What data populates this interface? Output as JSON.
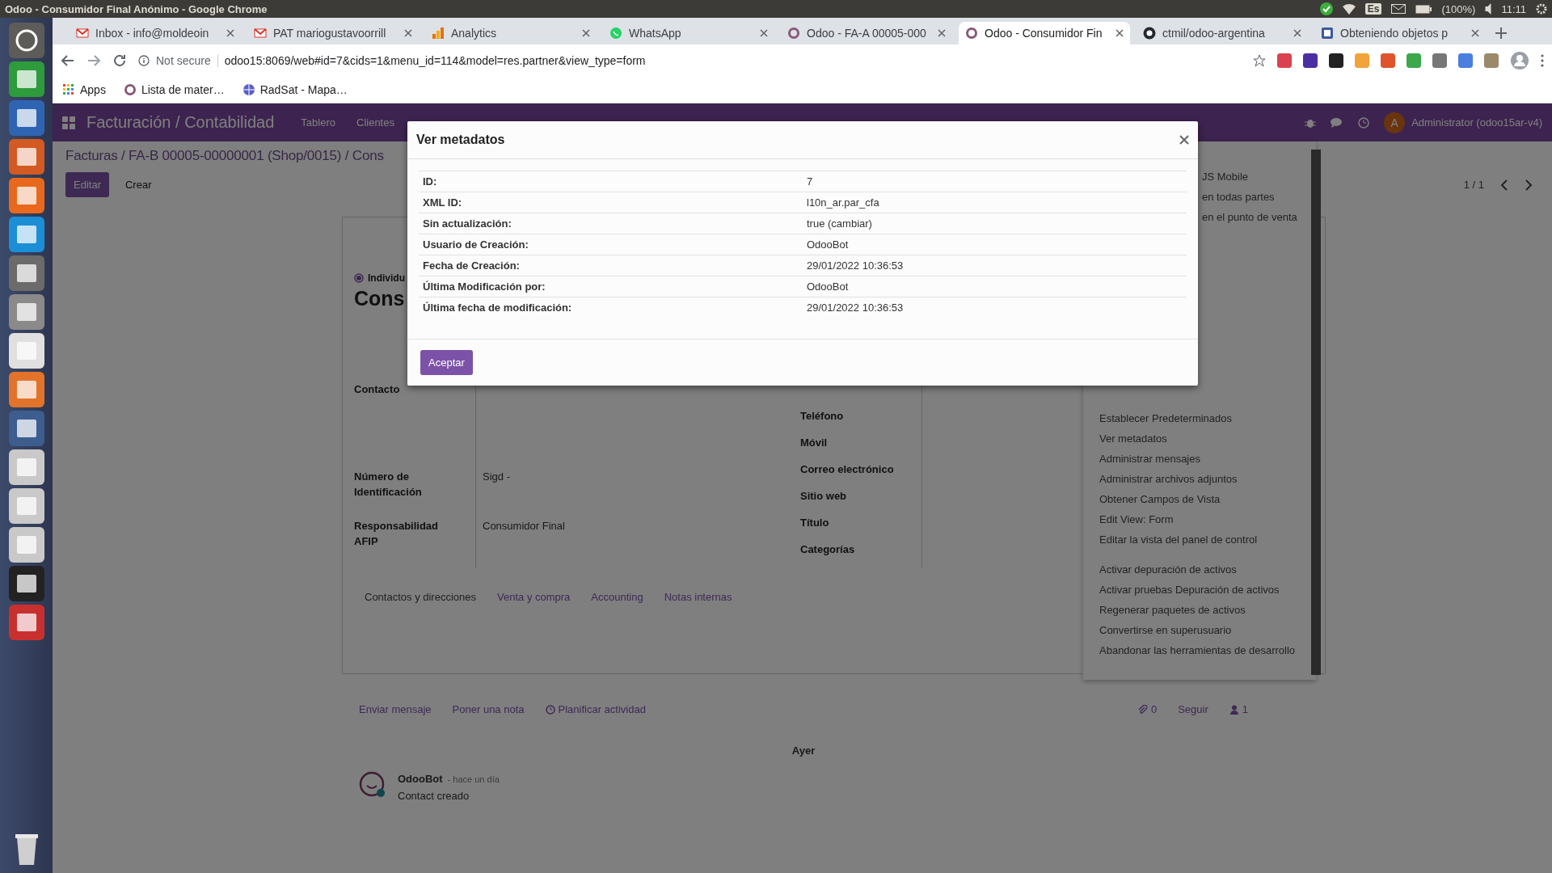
{
  "system_bar": {
    "title": "Odoo - Consumidor Final Anónimo - Google Chrome",
    "keyboard": "Es",
    "battery": "(100%)",
    "time": "11:11"
  },
  "browser": {
    "tabs": [
      {
        "title": "Inbox - info@moldeoin",
        "selected": false
      },
      {
        "title": "PAT mariogustavoorrill",
        "selected": false
      },
      {
        "title": "Analytics",
        "selected": false
      },
      {
        "title": "WhatsApp",
        "selected": false
      },
      {
        "title": "Odoo - FA-A 00005-000",
        "selected": false
      },
      {
        "title": "Odoo - Consumidor Fin",
        "selected": true
      },
      {
        "title": "ctmil/odoo-argentina",
        "selected": false
      },
      {
        "title": "Obteniendo objetos p",
        "selected": false
      }
    ],
    "security": "Not secure",
    "url": "odoo15:8069/web#id=7&cids=1&menu_id=114&model=res.partner&view_type=form",
    "bookmarks": [
      "Apps",
      "Lista de mater…",
      "RadSat - Mapa…"
    ]
  },
  "odoo": {
    "app_title": "Facturación / Contabilidad",
    "menu": [
      "Tablero",
      "Clientes"
    ],
    "user": "Administrator (odoo15ar-v4)",
    "avatar_letter": "A",
    "breadcrumb": "Facturas / FA-B 00005-00000001 (Shop/0015) / Cons",
    "buttons": [
      {
        "label": "Editar",
        "kind": "primary"
      },
      {
        "label": "Crear",
        "kind": "link"
      }
    ],
    "pager": "1 / 1",
    "form": {
      "radio": {
        "label": "Individu",
        "selected": true
      },
      "name": "Cons",
      "left_fields": [
        {
          "label": "Contacto"
        },
        {
          "label": "Número de Identificación",
          "value": "Sigd -"
        },
        {
          "label": "Responsabilidad AFIP",
          "value": "Consumidor Final"
        }
      ],
      "right_fields": [
        "Teléfono",
        "Móvil",
        "Correo electrónico",
        "Sitio web",
        "Título",
        "Categorías"
      ],
      "tabs": [
        {
          "label": "Contactos y direcciones",
          "selected": true
        },
        {
          "label": "Venta y compra",
          "selected": false
        },
        {
          "label": "Accounting",
          "selected": false
        },
        {
          "label": "Notas internas",
          "selected": false
        }
      ]
    },
    "debug_menu": {
      "partial_items": [
        "JS Mobile",
        "en todas partes",
        "en el punto de venta"
      ],
      "groups": [
        [
          "Establecer Predeterminados",
          "Ver metadatos",
          "Administrar mensajes",
          "Administrar archivos adjuntos",
          "Obtener Campos de Vista",
          "Edit View: Form",
          "Editar la vista del panel de control"
        ],
        [
          "Activar depuración de activos",
          "Activar pruebas Depuración de activos",
          "Regenerar paquetes de activos",
          "Convertirse en superusuario",
          "Abandonar las herramientas de desarrollo"
        ]
      ]
    },
    "chatter": {
      "actions": [
        "Enviar mensaje",
        "Poner una nota",
        "Planificar actividad"
      ],
      "attachments": "0",
      "follow": "Seguir",
      "followers": "1",
      "date_separator": "Ayer",
      "messages": [
        {
          "author": "OdooBot",
          "time": "- hace un día",
          "body": "Contact creado"
        }
      ]
    }
  },
  "dialog": {
    "title": "Ver metadatos",
    "rows": [
      {
        "label": "ID:",
        "value": "7"
      },
      {
        "label": "XML ID:",
        "value": "l10n_ar.par_cfa"
      },
      {
        "label": "Sin actualización:",
        "value": "true (cambiar)"
      },
      {
        "label": "Usuario de Creación:",
        "value": "OdooBot"
      },
      {
        "label": "Fecha de Creación:",
        "value": "29/01/2022 10:36:53"
      },
      {
        "label": "Última Modificación por:",
        "value": "OdooBot"
      },
      {
        "label": "Última fecha de modificación:",
        "value": "29/01/2022 10:36:53"
      }
    ],
    "button": "Aceptar"
  }
}
